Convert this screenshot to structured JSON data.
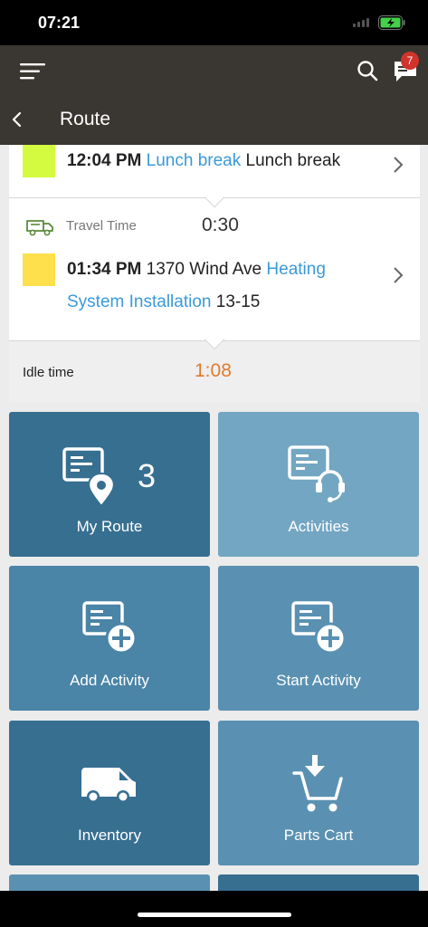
{
  "status_bar": {
    "time": "07:21"
  },
  "header": {
    "title": "Route",
    "notification_count": "7"
  },
  "route": {
    "activities": [
      {
        "time": "12:04 PM",
        "address": "",
        "type": "Lunch break",
        "name": "Lunch break",
        "marker_color": "#d4fb3f"
      },
      {
        "time": "01:34 PM",
        "address": "1370 Wind Ave",
        "type_line1": "Heating",
        "type_line2": "System Installation",
        "name": "13-15",
        "marker_color": "#fde04b"
      }
    ],
    "travel": {
      "label": "Travel Time",
      "value": "0:30"
    },
    "idle": {
      "label": "Idle time",
      "value": "1:08"
    }
  },
  "tiles": [
    {
      "label": "My Route",
      "count": "3",
      "color": "#376f91"
    },
    {
      "label": "Activities",
      "color": "#73a6c2"
    },
    {
      "label": "Add Activity",
      "color": "#4a84a6"
    },
    {
      "label": "Start Activity",
      "color": "#5a91b2"
    },
    {
      "label": "Inventory",
      "color": "#376f91"
    },
    {
      "label": "Parts Cart",
      "color": "#5a91b2"
    }
  ]
}
